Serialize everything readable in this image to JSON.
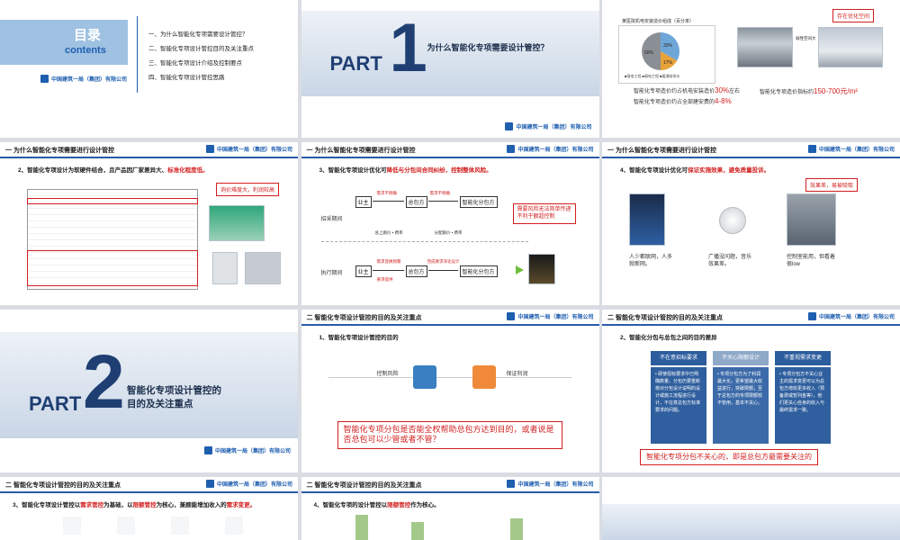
{
  "company": "中国建筑一局（集团）有限公司",
  "slide1": {
    "contents_title": "目录",
    "contents_en": "contents",
    "items": [
      "一、为什么智能化专项需要设计管控？",
      "二、智能化专项设计管控目的及关注重点",
      "三、智能化专项设计介绍及控制要点",
      "四、智能化专项设计管控思路"
    ]
  },
  "slide2": {
    "part": "PART",
    "num": "1",
    "title": "为什么智能化专项需要设计管控？"
  },
  "slide3": {
    "chart_title": "某医院机电安装造价组成（百分率）",
    "pie_labels": [
      "33%",
      "17%",
      "50%"
    ],
    "legend": "■强电工程 ■弱电工程 ■暖通给排水",
    "tag": "存在优化空间",
    "img_label": "弱性空间大",
    "line1_a": "智能化专项造价约占机电安装造价",
    "line1_b": "30%",
    "line1_c": "左右",
    "line2_a": "智能化专项造价约占全部建安费的",
    "line2_b": "4-8%",
    "line3_a": "智能化专项造价指标约",
    "line3_b": "150-700元/m²"
  },
  "slide4": {
    "header": "一 为什么智能化专项需要进行设计管控",
    "subtitle_a": "2、智能化专项设计为软硬件结合，且产品因厂家差异大、",
    "subtitle_b": "标准化程度低。",
    "callout": "询价难度大，利润较高"
  },
  "slide5": {
    "header": "一 为什么智能化专项需要进行设计管控",
    "subtitle_a": "3、智能化专项设计优化可",
    "subtitle_b": "降低与分包间合同纠纷，控制整体风险。",
    "row1_label": "招采期间",
    "row2_label": "执行期间",
    "owner": "业主",
    "gc": "总包方",
    "sub": "智能化分包方",
    "note_r1a": "需求不明确",
    "note_r1b": "需求不明确",
    "r1_below_a": "总上跟价 • 费率",
    "r1_below_b": "分配跟价 • 费率",
    "note_r2a": "需求变换频繁",
    "note_r2b": "要求提供",
    "note_r2c": "完成要求深化设计",
    "callout": "需要风险无法简单传递\n不利于额超控制"
  },
  "slide6": {
    "header": "一 为什么智能化专项需要进行设计管控",
    "subtitle_a": "4、智能化专项设计优化可",
    "subtitle_b": "保证实施效果，避免质量投诉。",
    "callout": "效果差，易被吸取",
    "cap1": "人少都联网，人多\n就断网。",
    "cap2": "广播没问题，音乐\n效果差。",
    "cap3": "控制室能用，但看着\n很low"
  },
  "slide7": {
    "part": "PART",
    "num": "2",
    "title_1": "智能化专项设计管控的",
    "title_2": "目的及关注重点"
  },
  "slide8": {
    "header": "二 智能化专项设计管控的目的及关注重点",
    "subtitle": "1、智能化专项设计管控的目的",
    "item1": "控制风险",
    "item2": "保证利润",
    "callout": "智能化专项分包是否能全权帮助总包方达到目的，或者说是否总包可以少管或者不管？"
  },
  "slide9": {
    "header": "二 智能化专项设计管控的目的及关注重点",
    "subtitle": "2、智能化分包与总包之间的目的差异",
    "col1_head": "不在意招标要求",
    "col2_head": "不关心限额设计",
    "col3_head": "不重视需求变更",
    "col1_body": "• 即使招标要求中已明确数量，分包仍要重新核对分包设计说明的设计或施工流程进行设计，不在意总包方标准要求的问题。",
    "col2_body": "• 专项分包方为了利润最大化，更希望最大收益进行，突破限额；至于总包方的专项限额较不管用，基本不关心。",
    "col3_body": "• 专项分包方不关心业主的需求变更可以为总包方增收更多收入（预备费或暂列金等），他们更关心自身的收入与最终需求一致。",
    "callout": "智能化专项分包不关心的，即是总包方最需要关注的"
  },
  "slide10": {
    "header": "二 智能化专项设计管控的目的及关注重点",
    "subtitle_a": "3、智能化专项设计管控以",
    "subtitle_b": "需求管控",
    "subtitle_c": "为基础，以",
    "subtitle_d": "限额管控",
    "subtitle_e": "为核心，兼顾能增加收入的",
    "subtitle_f": "需求变更。"
  },
  "slide11": {
    "header": "二 智能化专项设计管控的目的及关注重点",
    "subtitle_a": "4、智能化专项的设计管控以",
    "subtitle_b": "限额管控",
    "subtitle_c": "作为核心。"
  }
}
